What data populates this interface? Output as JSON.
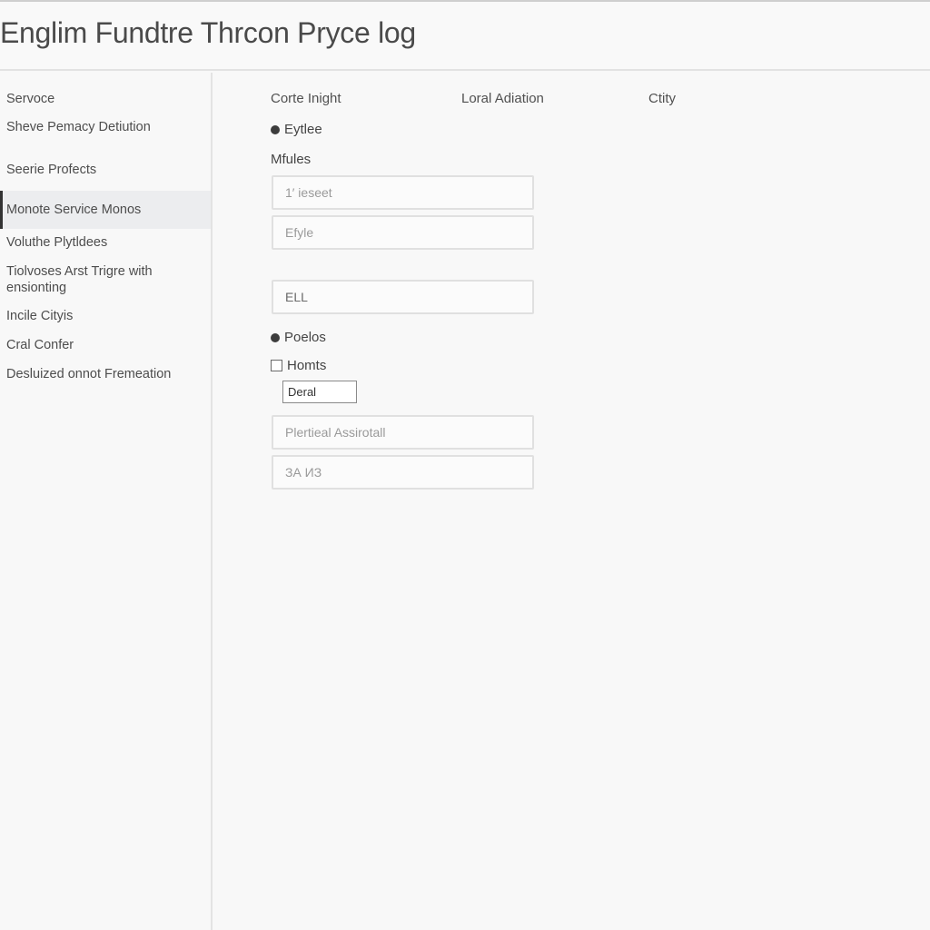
{
  "window": {
    "title": "Englim Fundtre Thrcon Pryce log"
  },
  "sidebar": {
    "items": [
      {
        "label": "Servoce"
      },
      {
        "label": "Sheve Pemacy Detiution"
      },
      {
        "label": "Seerie Profects"
      },
      {
        "label": "Monote Service Monos",
        "active": true
      },
      {
        "label": "Voluthe Plytldees"
      },
      {
        "label": "Tiolvoses Arst Trigre with ensionting"
      },
      {
        "label": "Incile Cityis"
      },
      {
        "label": "Cral Confer"
      },
      {
        "label": "Desluized onnot Fremeation"
      }
    ]
  },
  "main": {
    "columns": [
      "Corte Inight",
      "Loral Adiation",
      "Ctity"
    ],
    "radio_1": {
      "label": "Eytlee",
      "selected": true
    },
    "section_label": "Mfules",
    "field_1": {
      "value": "1′ ieseet"
    },
    "field_2": {
      "value": "Efyle"
    },
    "field_3": {
      "value": "ELL"
    },
    "radio_2": {
      "label": "Poelos",
      "selected": true
    },
    "checkbox": {
      "label": "Homts",
      "checked": false
    },
    "small_input": {
      "value": "Deral"
    },
    "field_4": {
      "value": "Plertieal Assirotall"
    },
    "field_5": {
      "value": "ЗА ИЗ"
    }
  }
}
